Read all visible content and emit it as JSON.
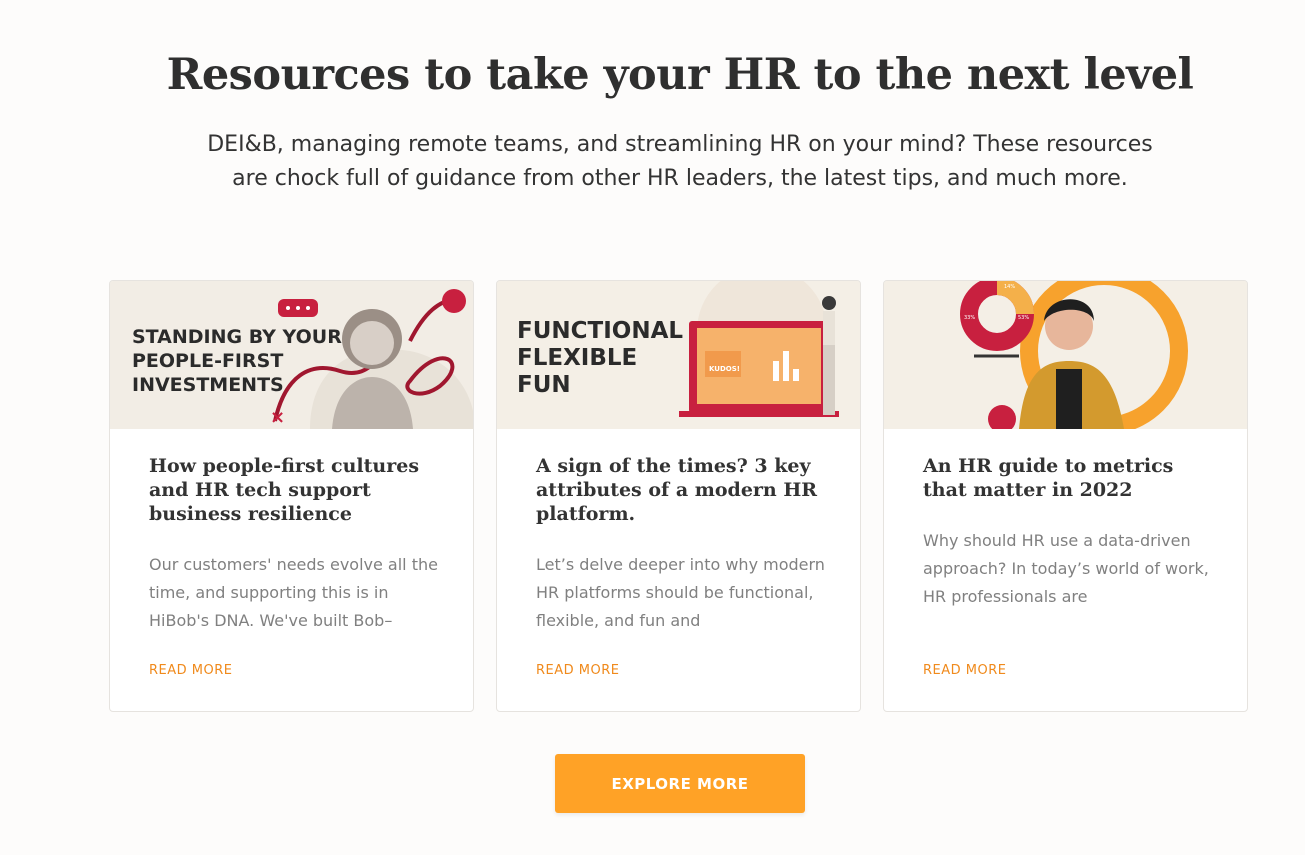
{
  "section": {
    "title": "Resources to take your HR to the next level",
    "subtitle": "DEI&B, managing remote teams, and streamlining HR on your mind? These resources are chock full of guidance from other HR leaders, the latest tips, and much more."
  },
  "cards": [
    {
      "banner_lines": [
        "STANDING BY YOUR",
        "PEOPLE-FIRST",
        "INVESTMENTS"
      ],
      "title": "How people-first cultures and HR tech support business resilience",
      "excerpt": "Our customers' needs evolve all the time, and supporting this is in HiBob's DNA. We've built Bob–",
      "link": "READ MORE"
    },
    {
      "banner_lines": [
        "FUNCTIONAL",
        "FLEXIBLE",
        "FUN"
      ],
      "banner_badge": "KUDOS!",
      "title": "A sign of the times? 3 key attributes of a modern HR platform.",
      "excerpt": "Let’s delve deeper into why modern HR platforms should be functional, flexible, and fun and",
      "link": "READ MORE"
    },
    {
      "banner_labels": [
        "14%",
        "53%",
        "33%"
      ],
      "title": "An HR guide to metrics that matter in 2022",
      "excerpt": "Why should HR use a data-driven approach? In today’s world of work, HR professionals are",
      "link": "READ MORE"
    }
  ],
  "explore_button": "EXPLORE MORE",
  "colors": {
    "accent": "#ffa226",
    "link": "#f08a1c",
    "crimson": "#c8203f"
  }
}
